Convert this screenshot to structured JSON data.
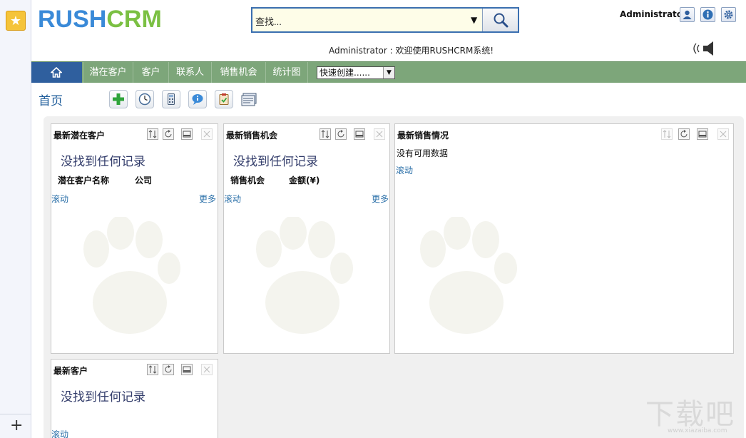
{
  "header": {
    "logo_part1": "RUSH",
    "logo_part2": "CRM",
    "search_placeholder": "查找...",
    "user": "Administrator",
    "welcome": "Administrator : 欢迎使用RUSHCRM系统!",
    "icons": [
      "user-icon",
      "info-icon",
      "settings-icon"
    ]
  },
  "nav": {
    "items": [
      "潜在客户",
      "客户",
      "联系人",
      "销售机会",
      "统计图"
    ],
    "quick_create": "快速创建......"
  },
  "page": {
    "title": "首页",
    "toolbar_icons": [
      "add-icon",
      "clock-icon",
      "calculator-icon",
      "chat-icon",
      "clipboard-icon",
      "layout-icon"
    ]
  },
  "panels": {
    "leads": {
      "title": "最新潜在客户",
      "empty": "没找到任何记录",
      "col1": "潜在客户名称",
      "col2": "公司",
      "scroll": "滚动",
      "more": "更多"
    },
    "opps": {
      "title": "最新销售机会",
      "empty": "没找到任何记录",
      "col1": "销售机会",
      "col2": "金额(¥)",
      "scroll": "滚动",
      "more": "更多"
    },
    "sales": {
      "title": "最新销售情况",
      "nodata": "没有可用数据",
      "scroll": "滚动"
    },
    "accounts": {
      "title": "最新客户",
      "empty": "没找到任何记录",
      "scroll": "滚动"
    }
  },
  "watermark": {
    "text": "下载吧",
    "url": "www.xiazaiba.com"
  },
  "colors": {
    "nav_bg": "#7da67a",
    "home_bg": "#2f5f9e",
    "logo_blue": "#3a8ad8",
    "logo_green": "#7bc043"
  }
}
